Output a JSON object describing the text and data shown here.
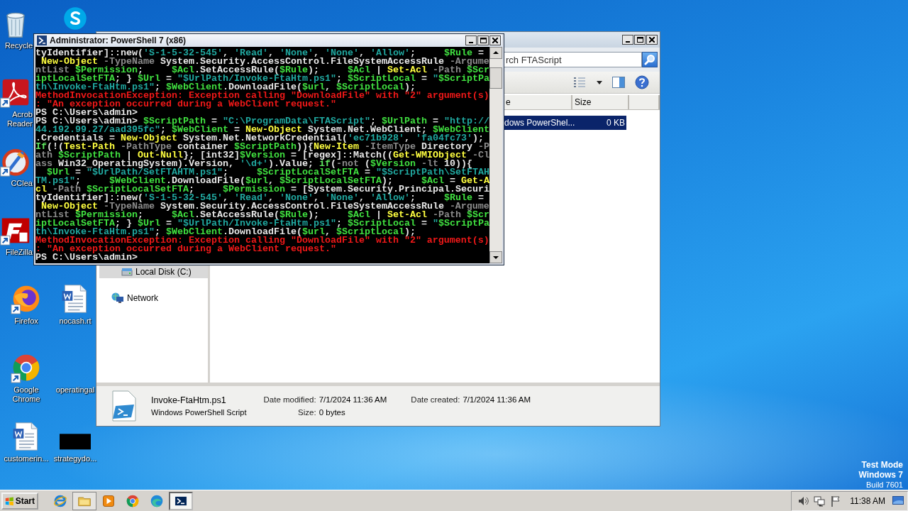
{
  "desktop": {
    "icons": [
      {
        "kind": "bin",
        "lines": [
          "Recycle"
        ],
        "shortcut": false
      },
      {
        "kind": "chat",
        "shortcut": false
      },
      {
        "kind": "pdf",
        "lines": [
          "Acrob",
          "Reader"
        ],
        "shortcut": true
      },
      {
        "kind": "cleaner",
        "lines": [
          "CClea"
        ],
        "shortcut": true
      },
      {
        "kind": "ftp",
        "lines": [
          "FileZilla"
        ],
        "shortcut": true
      },
      {
        "kind": "fox",
        "lines": [
          "Firefox"
        ],
        "shortcut": true
      },
      {
        "kind": "document",
        "lines": [
          "nocash.rt"
        ],
        "shortcut": false
      },
      {
        "kind": "chrome",
        "lines": [
          "Google",
          "Chrome"
        ],
        "shortcut": true
      },
      {
        "kind": "none",
        "lines": [
          "operatingal"
        ]
      },
      {
        "kind": "document",
        "lines": [
          "customerin..."
        ],
        "shortcut": false
      },
      {
        "kind": "thumbnail",
        "lines": [
          "strategydo..."
        ],
        "shortcut": false
      }
    ],
    "test_mode": {
      "title": "Test Mode",
      "edition": "Windows 7",
      "build": "Build 7601"
    }
  },
  "explorer": {
    "search": {
      "placeholder": "rch FTAScript"
    },
    "columns": [
      {
        "label": "e"
      },
      {
        "label": "Size"
      }
    ],
    "rows": [
      {
        "cells": [
          "dows PowerShel...",
          "0 KB"
        ],
        "selected": true
      }
    ],
    "nav": [
      {
        "kind": "drive",
        "label": "Local Disk (C:)",
        "selected": true
      },
      {
        "kind": "network",
        "label": "Network",
        "selected": false
      }
    ],
    "details": {
      "name": "Invoke-FtaHtm.ps1",
      "type": "Windows PowerShell Script",
      "fields": [
        {
          "label": "Date modified:",
          "value": "7/1/2024 11:36 AM"
        },
        {
          "label": "Date created:",
          "value": "7/1/2024 11:36 AM"
        },
        {
          "label": "Size:",
          "value": "0 bytes"
        }
      ]
    }
  },
  "powershell": {
    "title": "Administrator: PowerShell 7 (x86)",
    "lines": [
      {
        "segments": [
          {
            "kind": "plain",
            "text": "tyIdentifier]::new("
          },
          {
            "kind": "string",
            "text": "'S-1-5-32-545'"
          },
          {
            "kind": "plain",
            "text": ", "
          },
          {
            "kind": "string",
            "text": "'Read'"
          },
          {
            "kind": "plain",
            "text": ", "
          },
          {
            "kind": "string",
            "text": "'None'"
          },
          {
            "kind": "plain",
            "text": ", "
          },
          {
            "kind": "string",
            "text": "'None'"
          },
          {
            "kind": "plain",
            "text": ", "
          },
          {
            "kind": "string",
            "text": "'Allow'"
          },
          {
            "kind": "plain",
            "text": ";     "
          },
          {
            "kind": "variable",
            "text": "$Rule"
          },
          {
            "kind": "plain",
            "text": " ="
          }
        ]
      },
      {
        "segments": [
          {
            "kind": "command",
            "text": " New-Object"
          },
          {
            "kind": "parameter",
            "text": " -TypeName"
          },
          {
            "kind": "plain",
            "text": " System.Security.AccessControl.FileSystemAccessRule "
          },
          {
            "kind": "parameter",
            "text": "-Argume"
          }
        ]
      },
      {
        "segments": [
          {
            "kind": "parameter",
            "text": "ntList"
          },
          {
            "kind": "variable",
            "text": " $Permission"
          },
          {
            "kind": "plain",
            "text": ";     "
          },
          {
            "kind": "variable",
            "text": "$Acl"
          },
          {
            "kind": "plain",
            "text": ".SetAccessRule("
          },
          {
            "kind": "variable",
            "text": "$Rule"
          },
          {
            "kind": "plain",
            "text": ");     "
          },
          {
            "kind": "variable",
            "text": "$Acl"
          },
          {
            "kind": "plain",
            "text": " | "
          },
          {
            "kind": "command",
            "text": "Set-Acl"
          },
          {
            "kind": "parameter",
            "text": " -Path"
          },
          {
            "kind": "variable",
            "text": " $Scr"
          }
        ]
      },
      {
        "segments": [
          {
            "kind": "variable",
            "text": "iptLocalSetFTA"
          },
          {
            "kind": "plain",
            "text": "; } "
          },
          {
            "kind": "variable",
            "text": "$Url"
          },
          {
            "kind": "plain",
            "text": " = "
          },
          {
            "kind": "string",
            "text": "\"$UrlPath/Invoke-FtaHtm.ps1\""
          },
          {
            "kind": "plain",
            "text": "; "
          },
          {
            "kind": "variable",
            "text": "$ScriptLocal"
          },
          {
            "kind": "plain",
            "text": " = "
          },
          {
            "kind": "string",
            "text": "\""
          },
          {
            "kind": "variable",
            "text": "$ScriptPa"
          }
        ]
      },
      {
        "segments": [
          {
            "kind": "string",
            "text": "th\\Invoke-FtaHtm.ps1\""
          },
          {
            "kind": "plain",
            "text": "; "
          },
          {
            "kind": "variable",
            "text": "$WebClient"
          },
          {
            "kind": "plain",
            "text": ".DownloadFile("
          },
          {
            "kind": "variable",
            "text": "$url"
          },
          {
            "kind": "plain",
            "text": ", "
          },
          {
            "kind": "variable",
            "text": "$ScriptLocal"
          },
          {
            "kind": "plain",
            "text": ");"
          }
        ]
      },
      {
        "segments": [
          {
            "kind": "error",
            "text": "MethodInvocationException: Exception calling \"DownloadFile\" with \"2\" argument(s)"
          }
        ]
      },
      {
        "segments": [
          {
            "kind": "error",
            "text": ": \"An exception occurred during a WebClient request.\""
          }
        ]
      },
      {
        "segments": [
          {
            "kind": "plain",
            "text": "PS C:\\Users\\admin>"
          }
        ]
      },
      {
        "segments": [
          {
            "kind": "plain",
            "text": "PS C:\\Users\\admin> "
          },
          {
            "kind": "variable",
            "text": "$ScriptPath"
          },
          {
            "kind": "plain",
            "text": " = "
          },
          {
            "kind": "string",
            "text": "\"C:\\ProgramData\\FTAScript\""
          },
          {
            "kind": "plain",
            "text": "; "
          },
          {
            "kind": "variable",
            "text": "$UrlPath"
          },
          {
            "kind": "plain",
            "text": " = "
          },
          {
            "kind": "string",
            "text": "\"http://"
          }
        ]
      },
      {
        "segments": [
          {
            "kind": "string",
            "text": "44.192.99.27/aad395fc\""
          },
          {
            "kind": "plain",
            "text": "; "
          },
          {
            "kind": "variable",
            "text": "$WebClient"
          },
          {
            "kind": "plain",
            "text": " = "
          },
          {
            "kind": "command",
            "text": "New-Object"
          },
          {
            "kind": "plain",
            "text": " System.Net.WebClient; "
          },
          {
            "kind": "variable",
            "text": "$WebClient"
          }
        ]
      },
      {
        "segments": [
          {
            "kind": "plain",
            "text": ".Credentials = "
          },
          {
            "kind": "command",
            "text": "New-Object"
          },
          {
            "kind": "plain",
            "text": " System.Net.NetworkCredential("
          },
          {
            "kind": "string",
            "text": "'ec71b928'"
          },
          {
            "kind": "plain",
            "text": ", "
          },
          {
            "kind": "string",
            "text": "'fa04fc73'"
          },
          {
            "kind": "plain",
            "text": ");"
          }
        ]
      },
      {
        "segments": [
          {
            "kind": "keyword",
            "text": "If"
          },
          {
            "kind": "plain",
            "text": "(!("
          },
          {
            "kind": "command",
            "text": "Test-Path"
          },
          {
            "kind": "parameter",
            "text": " -PathType"
          },
          {
            "kind": "plain",
            "text": " container "
          },
          {
            "kind": "variable",
            "text": "$ScriptPath"
          },
          {
            "kind": "plain",
            "text": ")){"
          },
          {
            "kind": "command",
            "text": "New-Item"
          },
          {
            "kind": "parameter",
            "text": " -ItemType"
          },
          {
            "kind": "plain",
            "text": " Directory "
          },
          {
            "kind": "parameter",
            "text": "-P"
          }
        ]
      },
      {
        "segments": [
          {
            "kind": "parameter",
            "text": "ath"
          },
          {
            "kind": "variable",
            "text": " $ScriptPath"
          },
          {
            "kind": "plain",
            "text": " | "
          },
          {
            "kind": "command",
            "text": "Out-Null"
          },
          {
            "kind": "plain",
            "text": "}; [int32]"
          },
          {
            "kind": "variable",
            "text": "$Version"
          },
          {
            "kind": "plain",
            "text": " = [regex]::Match(("
          },
          {
            "kind": "command",
            "text": "Get-WMIObject"
          },
          {
            "kind": "parameter",
            "text": " -Cl"
          }
        ]
      },
      {
        "segments": [
          {
            "kind": "parameter",
            "text": "ass"
          },
          {
            "kind": "plain",
            "text": " Win32_OperatingSystem).Version, "
          },
          {
            "kind": "string",
            "text": "'\\d+'"
          },
          {
            "kind": "plain",
            "text": ").Value; "
          },
          {
            "kind": "keyword",
            "text": "if"
          },
          {
            "kind": "plain",
            "text": "("
          },
          {
            "kind": "parameter",
            "text": "-not"
          },
          {
            "kind": "plain",
            "text": " ("
          },
          {
            "kind": "variable",
            "text": "$Version"
          },
          {
            "kind": "parameter",
            "text": " -lt"
          },
          {
            "kind": "plain",
            "text": " 10)){"
          }
        ]
      },
      {
        "segments": [
          {
            "kind": "variable",
            "text": "  $Url"
          },
          {
            "kind": "plain",
            "text": " = "
          },
          {
            "kind": "string",
            "text": "\"$UrlPath/SetFTAHTM.ps1\""
          },
          {
            "kind": "plain",
            "text": ";     "
          },
          {
            "kind": "variable",
            "text": "$ScriptLocalSetFTA"
          },
          {
            "kind": "plain",
            "text": " = "
          },
          {
            "kind": "string",
            "text": "\"$ScriptPath\\SetFTAH"
          }
        ]
      },
      {
        "segments": [
          {
            "kind": "string",
            "text": "TM.ps1\""
          },
          {
            "kind": "plain",
            "text": ";     "
          },
          {
            "kind": "variable",
            "text": "$WebClient"
          },
          {
            "kind": "plain",
            "text": ".DownloadFile("
          },
          {
            "kind": "variable",
            "text": "$url"
          },
          {
            "kind": "plain",
            "text": ", "
          },
          {
            "kind": "variable",
            "text": "$ScriptLocalSetFTA"
          },
          {
            "kind": "plain",
            "text": ");     "
          },
          {
            "kind": "variable",
            "text": "$Acl"
          },
          {
            "kind": "plain",
            "text": " = "
          },
          {
            "kind": "command",
            "text": "Get-A"
          }
        ]
      },
      {
        "segments": [
          {
            "kind": "command",
            "text": "cl"
          },
          {
            "kind": "parameter",
            "text": " -Path"
          },
          {
            "kind": "variable",
            "text": " $ScriptLocalSetFTA"
          },
          {
            "kind": "plain",
            "text": ";     "
          },
          {
            "kind": "variable",
            "text": "$Permission"
          },
          {
            "kind": "plain",
            "text": " = [System.Security.Principal.Securi"
          }
        ]
      },
      {
        "segments": [
          {
            "kind": "plain",
            "text": "tyIdentifier]::new("
          },
          {
            "kind": "string",
            "text": "'S-1-5-32-545'"
          },
          {
            "kind": "plain",
            "text": ", "
          },
          {
            "kind": "string",
            "text": "'Read'"
          },
          {
            "kind": "plain",
            "text": ", "
          },
          {
            "kind": "string",
            "text": "'None'"
          },
          {
            "kind": "plain",
            "text": ", "
          },
          {
            "kind": "string",
            "text": "'None'"
          },
          {
            "kind": "plain",
            "text": ", "
          },
          {
            "kind": "string",
            "text": "'Allow'"
          },
          {
            "kind": "plain",
            "text": ";     "
          },
          {
            "kind": "variable",
            "text": "$Rule"
          },
          {
            "kind": "plain",
            "text": " ="
          }
        ]
      },
      {
        "segments": [
          {
            "kind": "command",
            "text": " New-Object"
          },
          {
            "kind": "parameter",
            "text": " -TypeName"
          },
          {
            "kind": "plain",
            "text": " System.Security.AccessControl.FileSystemAccessRule "
          },
          {
            "kind": "parameter",
            "text": "-Argume"
          }
        ]
      },
      {
        "segments": [
          {
            "kind": "parameter",
            "text": "ntList"
          },
          {
            "kind": "variable",
            "text": " $Permission"
          },
          {
            "kind": "plain",
            "text": ";     "
          },
          {
            "kind": "variable",
            "text": "$Acl"
          },
          {
            "kind": "plain",
            "text": ".SetAccessRule("
          },
          {
            "kind": "variable",
            "text": "$Rule"
          },
          {
            "kind": "plain",
            "text": ");     "
          },
          {
            "kind": "variable",
            "text": "$Acl"
          },
          {
            "kind": "plain",
            "text": " | "
          },
          {
            "kind": "command",
            "text": "Set-Acl"
          },
          {
            "kind": "parameter",
            "text": " -Path"
          },
          {
            "kind": "variable",
            "text": " $Scr"
          }
        ]
      },
      {
        "segments": [
          {
            "kind": "variable",
            "text": "iptLocalSetFTA"
          },
          {
            "kind": "plain",
            "text": "; } "
          },
          {
            "kind": "variable",
            "text": "$Url"
          },
          {
            "kind": "plain",
            "text": " = "
          },
          {
            "kind": "string",
            "text": "\"$UrlPath/Invoke-FtaHtm.ps1\""
          },
          {
            "kind": "plain",
            "text": "; "
          },
          {
            "kind": "variable",
            "text": "$ScriptLocal"
          },
          {
            "kind": "plain",
            "text": " = "
          },
          {
            "kind": "string",
            "text": "\""
          },
          {
            "kind": "variable",
            "text": "$ScriptPa"
          }
        ]
      },
      {
        "segments": [
          {
            "kind": "string",
            "text": "th\\Invoke-FtaHtm.ps1\""
          },
          {
            "kind": "plain",
            "text": "; "
          },
          {
            "kind": "variable",
            "text": "$WebClient"
          },
          {
            "kind": "plain",
            "text": ".DownloadFile("
          },
          {
            "kind": "variable",
            "text": "$url"
          },
          {
            "kind": "plain",
            "text": ", "
          },
          {
            "kind": "variable",
            "text": "$ScriptLocal"
          },
          {
            "kind": "plain",
            "text": ");"
          }
        ]
      },
      {
        "segments": [
          {
            "kind": "error",
            "text": "MethodInvocationException: Exception calling \"DownloadFile\" with \"2\" argument(s)"
          }
        ]
      },
      {
        "segments": [
          {
            "kind": "error",
            "text": ": \"An exception occurred during a WebClient request.\""
          }
        ]
      },
      {
        "segments": [
          {
            "kind": "plain",
            "text": "PS C:\\Users\\admin>"
          }
        ]
      }
    ]
  },
  "taskbar": {
    "start": "Start",
    "items": [
      {
        "kind": "ie",
        "open": false,
        "selected": false
      },
      {
        "kind": "folder",
        "open": true,
        "selected": false
      },
      {
        "kind": "media",
        "open": false,
        "selected": false
      },
      {
        "kind": "chrome",
        "open": false,
        "selected": false
      },
      {
        "kind": "edge",
        "open": false,
        "selected": false
      },
      {
        "kind": "shell",
        "open": true,
        "selected": true
      }
    ],
    "clock": "11:38 AM"
  }
}
